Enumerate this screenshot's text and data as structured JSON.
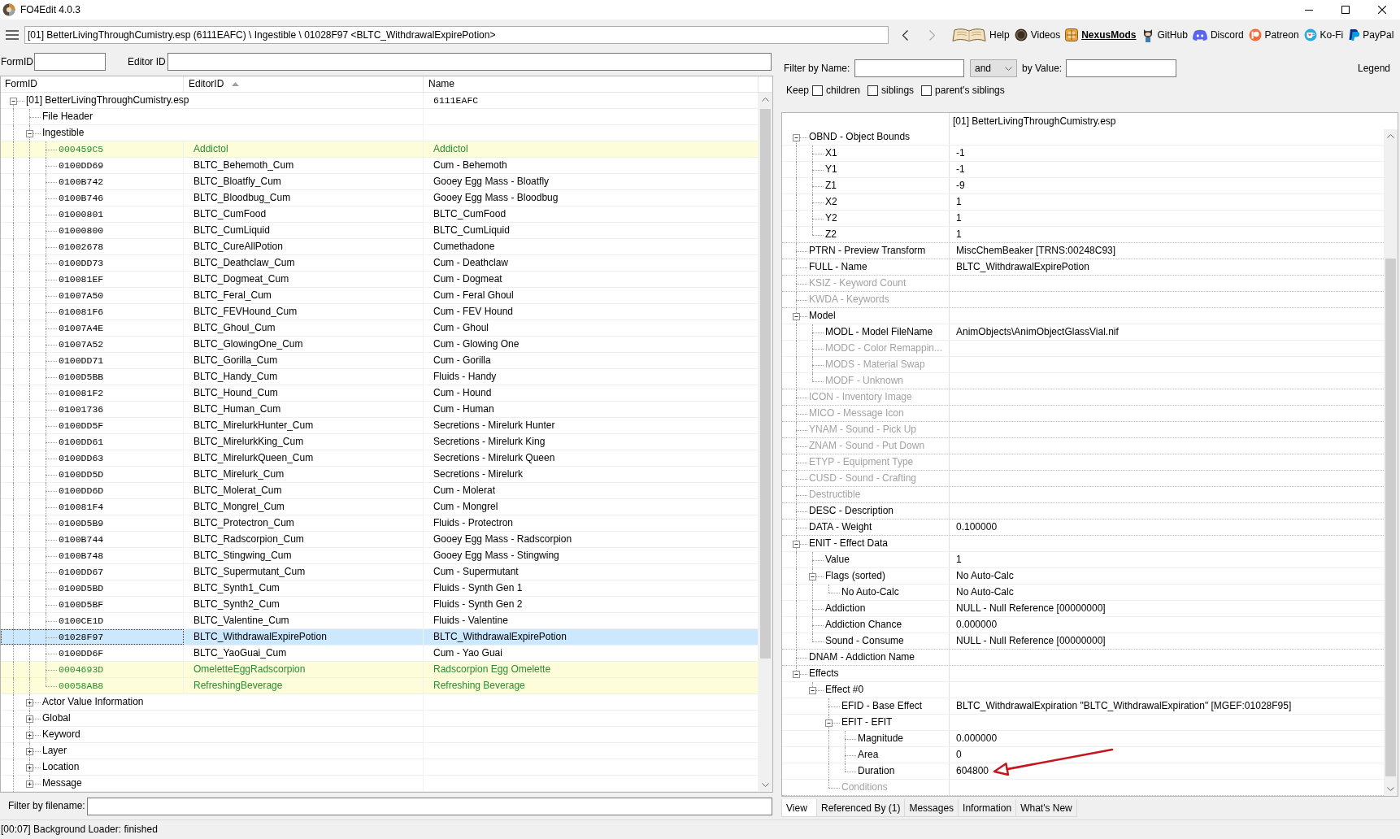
{
  "window": {
    "title": "FO4Edit 4.0.3"
  },
  "toolbar": {
    "path": "[01] BetterLivingThroughCumistry.esp (6111EAFC) \\ Ingestible \\ 01028F97 <BLTC_WithdrawalExpirePotion>",
    "nav": [
      {
        "kind": "back",
        "disabled": false
      },
      {
        "kind": "forward",
        "disabled": true
      }
    ],
    "links": [
      {
        "kind": "book",
        "label": "Help",
        "emphasized": false
      },
      {
        "kind": "coin",
        "label": "Videos",
        "emphasized": false
      },
      {
        "kind": "tile",
        "label": "NexusMods",
        "emphasized": true
      },
      {
        "kind": "cat",
        "label": "GitHub",
        "emphasized": false
      },
      {
        "kind": "controller",
        "label": "Discord",
        "emphasized": false
      },
      {
        "kind": "circle_bar",
        "label": "Patreon",
        "emphasized": false
      },
      {
        "kind": "cup",
        "label": "Ko-Fi",
        "emphasized": false
      },
      {
        "kind": "slanted",
        "label": "PayPal",
        "emphasized": false
      }
    ]
  },
  "filters": {
    "form_id_label": "FormID",
    "editor_id_label": "Editor ID"
  },
  "navigator": {
    "columns": [
      {
        "label": "FormID",
        "sorted": false
      },
      {
        "label": "EditorID",
        "sorted": true
      },
      {
        "label": "Name",
        "sorted": false
      }
    ],
    "tree": [
      {
        "label": "[01] BetterLivingThroughCumistry.esp",
        "name": "6111EAFC",
        "expanded": true,
        "selected": false,
        "highlighted": false,
        "children": [
          {
            "label": "File Header",
            "selected": false,
            "highlighted": false
          },
          {
            "label": "Ingestible",
            "expanded": true,
            "selected": false,
            "highlighted": false,
            "children": [
              {
                "form_id": "000459C5",
                "editor_id": "Addictol",
                "name": "Addictol",
                "selected": false,
                "highlighted": true
              },
              {
                "form_id": "0100DD69",
                "editor_id": "BLTC_Behemoth_Cum",
                "name": "Cum - Behemoth",
                "selected": false,
                "highlighted": false
              },
              {
                "form_id": "0100B742",
                "editor_id": "BLTC_Bloatfly_Cum",
                "name": "Gooey Egg Mass - Bloatfly",
                "selected": false,
                "highlighted": false
              },
              {
                "form_id": "0100B746",
                "editor_id": "BLTC_Bloodbug_Cum",
                "name": "Gooey Egg Mass - Bloodbug",
                "selected": false,
                "highlighted": false
              },
              {
                "form_id": "01000801",
                "editor_id": "BLTC_CumFood",
                "name": "BLTC_CumFood",
                "selected": false,
                "highlighted": false
              },
              {
                "form_id": "01000800",
                "editor_id": "BLTC_CumLiquid",
                "name": "BLTC_CumLiquid",
                "selected": false,
                "highlighted": false
              },
              {
                "form_id": "01002678",
                "editor_id": "BLTC_CureAllPotion",
                "name": "Cumethadone",
                "selected": false,
                "highlighted": false
              },
              {
                "form_id": "0100DD73",
                "editor_id": "BLTC_Deathclaw_Cum",
                "name": "Cum - Deathclaw",
                "selected": false,
                "highlighted": false
              },
              {
                "form_id": "010081EF",
                "editor_id": "BLTC_Dogmeat_Cum",
                "name": "Cum - Dogmeat",
                "selected": false,
                "highlighted": false
              },
              {
                "form_id": "01007A50",
                "editor_id": "BLTC_Feral_Cum",
                "name": "Cum - Feral Ghoul",
                "selected": false,
                "highlighted": false
              },
              {
                "form_id": "010081F6",
                "editor_id": "BLTC_FEVHound_Cum",
                "name": "Cum - FEV Hound",
                "selected": false,
                "highlighted": false
              },
              {
                "form_id": "01007A4E",
                "editor_id": "BLTC_Ghoul_Cum",
                "name": "Cum - Ghoul",
                "selected": false,
                "highlighted": false
              },
              {
                "form_id": "01007A52",
                "editor_id": "BLTC_GlowingOne_Cum",
                "name": "Cum - Glowing One",
                "selected": false,
                "highlighted": false
              },
              {
                "form_id": "0100DD71",
                "editor_id": "BLTC_Gorilla_Cum",
                "name": "Cum - Gorilla",
                "selected": false,
                "highlighted": false
              },
              {
                "form_id": "0100D5BB",
                "editor_id": "BLTC_Handy_Cum",
                "name": "Fluids - Handy",
                "selected": false,
                "highlighted": false
              },
              {
                "form_id": "010081F2",
                "editor_id": "BLTC_Hound_Cum",
                "name": "Cum - Hound",
                "selected": false,
                "highlighted": false
              },
              {
                "form_id": "01001736",
                "editor_id": "BLTC_Human_Cum",
                "name": "Cum - Human",
                "selected": false,
                "highlighted": false
              },
              {
                "form_id": "0100DD5F",
                "editor_id": "BLTC_MirelurkHunter_Cum",
                "name": "Secretions - Mirelurk Hunter",
                "selected": false,
                "highlighted": false
              },
              {
                "form_id": "0100DD61",
                "editor_id": "BLTC_MirelurkKing_Cum",
                "name": "Secretions - Mirelurk King",
                "selected": false,
                "highlighted": false
              },
              {
                "form_id": "0100DD63",
                "editor_id": "BLTC_MirelurkQueen_Cum",
                "name": "Secretions - Mirelurk Queen",
                "selected": false,
                "highlighted": false
              },
              {
                "form_id": "0100DD5D",
                "editor_id": "BLTC_Mirelurk_Cum",
                "name": "Secretions - Mirelurk",
                "selected": false,
                "highlighted": false
              },
              {
                "form_id": "0100DD6D",
                "editor_id": "BLTC_Molerat_Cum",
                "name": "Cum - Molerat",
                "selected": false,
                "highlighted": false
              },
              {
                "form_id": "010081F4",
                "editor_id": "BLTC_Mongrel_Cum",
                "name": "Cum - Mongrel",
                "selected": false,
                "highlighted": false
              },
              {
                "form_id": "0100D5B9",
                "editor_id": "BLTC_Protectron_Cum",
                "name": "Fluids - Protectron",
                "selected": false,
                "highlighted": false
              },
              {
                "form_id": "0100B744",
                "editor_id": "BLTC_Radscorpion_Cum",
                "name": "Gooey Egg Mass - Radscorpion",
                "selected": false,
                "highlighted": false
              },
              {
                "form_id": "0100B748",
                "editor_id": "BLTC_Stingwing_Cum",
                "name": "Gooey Egg Mass - Stingwing",
                "selected": false,
                "highlighted": false
              },
              {
                "form_id": "0100DD67",
                "editor_id": "BLTC_Supermutant_Cum",
                "name": "Cum - Supermutant",
                "selected": false,
                "highlighted": false
              },
              {
                "form_id": "0100D5BD",
                "editor_id": "BLTC_Synth1_Cum",
                "name": "Fluids - Synth Gen 1",
                "selected": false,
                "highlighted": false
              },
              {
                "form_id": "0100D5BF",
                "editor_id": "BLTC_Synth2_Cum",
                "name": "Fluids - Synth Gen 2",
                "selected": false,
                "highlighted": false
              },
              {
                "form_id": "0100CE1D",
                "editor_id": "BLTC_Valentine_Cum",
                "name": "Fluids - Valentine",
                "selected": false,
                "highlighted": false
              },
              {
                "form_id": "01028F97",
                "editor_id": "BLTC_WithdrawalExpirePotion",
                "name": "BLTC_WithdrawalExpirePotion",
                "selected": true,
                "highlighted": false
              },
              {
                "form_id": "0100DD6F",
                "editor_id": "BLTC_YaoGuai_Cum",
                "name": "Cum - Yao Guai",
                "selected": false,
                "highlighted": false
              },
              {
                "form_id": "0004693D",
                "editor_id": "OmeletteEggRadscorpion",
                "name": "Radscorpion Egg Omelette",
                "selected": false,
                "highlighted": true
              },
              {
                "form_id": "00058AB8",
                "editor_id": "RefreshingBeverage",
                "name": "Refreshing Beverage",
                "selected": false,
                "highlighted": true
              }
            ]
          },
          {
            "label": "Actor Value Information",
            "expanded": false,
            "selected": false,
            "highlighted": false
          },
          {
            "label": "Global",
            "expanded": false,
            "selected": false,
            "highlighted": false
          },
          {
            "label": "Keyword",
            "expanded": false,
            "selected": false,
            "highlighted": false
          },
          {
            "label": "Layer",
            "expanded": false,
            "selected": false,
            "highlighted": false
          },
          {
            "label": "Location",
            "expanded": false,
            "selected": false,
            "highlighted": false
          },
          {
            "label": "Message",
            "expanded": false,
            "selected": false,
            "highlighted": false
          }
        ]
      }
    ]
  },
  "filename_filter": {
    "label": "Filter by filename:"
  },
  "record_view": {
    "filter": {
      "name_label": "Filter by Name:",
      "operator": "and",
      "value_label": "by Value:",
      "legend": "Legend"
    },
    "keep": {
      "label": "Keep",
      "options": [
        {
          "label": "children",
          "checked": false
        },
        {
          "label": "siblings",
          "checked": false
        },
        {
          "label": "parent's siblings",
          "checked": false
        }
      ]
    },
    "column_header": "[01] BetterLivingThroughCumistry.esp",
    "tree": [
      {
        "label": "OBND - Object Bounds",
        "disabled": false,
        "annotated": false,
        "expanded": true,
        "children": [
          {
            "label": "X1",
            "value": "-1",
            "disabled": false,
            "annotated": false
          },
          {
            "label": "Y1",
            "value": "-1",
            "disabled": false,
            "annotated": false
          },
          {
            "label": "Z1",
            "value": "-9",
            "disabled": false,
            "annotated": false
          },
          {
            "label": "X2",
            "value": "1",
            "disabled": false,
            "annotated": false
          },
          {
            "label": "Y2",
            "value": "1",
            "disabled": false,
            "annotated": false
          },
          {
            "label": "Z2",
            "value": "1",
            "disabled": false,
            "annotated": false
          }
        ]
      },
      {
        "label": "PTRN - Preview Transform",
        "value": "MiscChemBeaker [TRNS:00248C93]",
        "disabled": false,
        "annotated": false
      },
      {
        "label": "FULL - Name",
        "value": "BLTC_WithdrawalExpirePotion",
        "disabled": false,
        "annotated": false
      },
      {
        "label": "KSIZ - Keyword Count",
        "disabled": true,
        "annotated": false
      },
      {
        "label": "KWDA - Keywords",
        "disabled": true,
        "annotated": false
      },
      {
        "label": "Model",
        "disabled": false,
        "annotated": false,
        "expanded": true,
        "children": [
          {
            "label": "MODL - Model FileName",
            "value": "AnimObjects\\AnimObjectGlassVial.nif",
            "disabled": false,
            "annotated": false
          },
          {
            "label": "MODC - Color Remappin...",
            "disabled": true,
            "annotated": false
          },
          {
            "label": "MODS - Material Swap",
            "disabled": true,
            "annotated": false
          },
          {
            "label": "MODF - Unknown",
            "disabled": true,
            "annotated": false
          }
        ]
      },
      {
        "label": "ICON - Inventory Image",
        "disabled": true,
        "annotated": false
      },
      {
        "label": "MICO - Message Icon",
        "disabled": true,
        "annotated": false
      },
      {
        "label": "YNAM - Sound - Pick Up",
        "disabled": true,
        "annotated": false
      },
      {
        "label": "ZNAM - Sound - Put Down",
        "disabled": true,
        "annotated": false
      },
      {
        "label": "ETYP - Equipment Type",
        "disabled": true,
        "annotated": false
      },
      {
        "label": "CUSD - Sound - Crafting",
        "disabled": true,
        "annotated": false
      },
      {
        "label": "Destructible",
        "disabled": true,
        "annotated": false
      },
      {
        "label": "DESC - Description",
        "disabled": false,
        "annotated": false
      },
      {
        "label": "DATA - Weight",
        "value": "0.100000",
        "disabled": false,
        "annotated": false
      },
      {
        "label": "ENIT - Effect Data",
        "disabled": false,
        "annotated": false,
        "expanded": true,
        "children": [
          {
            "label": "Value",
            "value": "1",
            "disabled": false,
            "annotated": false
          },
          {
            "label": "Flags (sorted)",
            "value": "No Auto-Calc",
            "disabled": false,
            "annotated": false,
            "expanded": true,
            "children": [
              {
                "label": "No Auto-Calc",
                "value": "No Auto-Calc",
                "disabled": false,
                "annotated": false
              }
            ]
          },
          {
            "label": "Addiction",
            "value": "NULL - Null Reference [00000000]",
            "disabled": false,
            "annotated": false
          },
          {
            "label": "Addiction Chance",
            "value": "0.000000",
            "disabled": false,
            "annotated": false
          },
          {
            "label": "Sound - Consume",
            "value": "NULL - Null Reference [00000000]",
            "disabled": false,
            "annotated": false
          }
        ]
      },
      {
        "label": "DNAM - Addiction Name",
        "disabled": false,
        "annotated": false
      },
      {
        "label": "Effects",
        "disabled": false,
        "annotated": false,
        "expanded": true,
        "children": [
          {
            "label": "Effect #0",
            "disabled": false,
            "annotated": false,
            "expanded": true,
            "children": [
              {
                "label": "EFID - Base Effect",
                "value": "BLTC_WithdrawalExpiration \"BLTC_WithdrawalExpiration\" [MGEF:01028F95]",
                "disabled": false,
                "annotated": false
              },
              {
                "label": "EFIT - EFIT",
                "disabled": false,
                "annotated": false,
                "expanded": true,
                "children": [
                  {
                    "label": "Magnitude",
                    "value": "0.000000",
                    "disabled": false,
                    "annotated": false
                  },
                  {
                    "label": "Area",
                    "value": "0",
                    "disabled": false,
                    "annotated": false
                  },
                  {
                    "label": "Duration",
                    "value": "604800",
                    "disabled": false,
                    "annotated": true
                  }
                ]
              },
              {
                "label": "Conditions",
                "disabled": true,
                "annotated": false
              }
            ]
          }
        ]
      }
    ],
    "tabs": [
      {
        "label": "View",
        "selected": true
      },
      {
        "label": "Referenced By (1)",
        "selected": false
      },
      {
        "label": "Messages",
        "selected": false
      },
      {
        "label": "Information",
        "selected": false
      },
      {
        "label": "What's New",
        "selected": false
      }
    ]
  },
  "status_bar": {
    "text": "[00:07] Background Loader: finished"
  }
}
